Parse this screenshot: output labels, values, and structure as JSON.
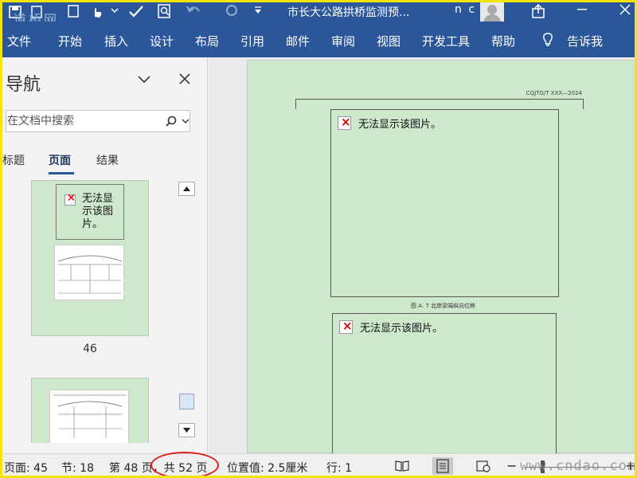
{
  "title_bar": {
    "document_title": "市长大公路拱桥监测预...",
    "user_initials": "n c",
    "watermark_logo": "道桥网"
  },
  "menu": {
    "tabs": [
      "文件",
      "开始",
      "插入",
      "设计",
      "布局",
      "引用",
      "邮件",
      "审阅",
      "视图",
      "开发工具",
      "帮助"
    ],
    "tell_me": "告诉我"
  },
  "nav_pane": {
    "title": "导航",
    "search_placeholder": "在文档中搜索",
    "tabs": [
      "标题",
      "页面",
      "结果"
    ],
    "active_tab": "页面",
    "thumbnails": [
      {
        "image_error": "无法显示该图片。",
        "page_number": "46"
      },
      {
        "page_number": ""
      }
    ]
  },
  "document": {
    "header_code": "CQJTG/T XXX—2024",
    "image_error_1": "无法显示该图片。",
    "figure_caption": "图 A. 7  北岸梁端纵向位移",
    "image_error_2": "无法显示该图片。"
  },
  "status_bar": {
    "page": "页面: 45",
    "section": "节: 18",
    "page_of": "第 48 页，共 52 页",
    "position": "位置值: 2.5厘米",
    "line": "行: 1",
    "zoom_minus": "−",
    "zoom_plus": "+",
    "site_watermark": "www.cndao.com"
  },
  "colors": {
    "ribbon": "#2b579a",
    "page_background": "#cde8cd",
    "frame_border": "#f2e600",
    "highlight_oval": "#e0201a"
  }
}
